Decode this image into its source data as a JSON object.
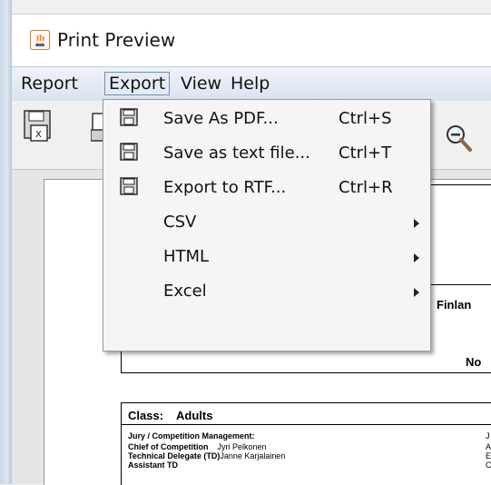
{
  "window": {
    "title": "Print Preview"
  },
  "menubar": {
    "items": [
      "Report",
      "Export",
      "View",
      "Help"
    ]
  },
  "export_menu": {
    "items": [
      {
        "label": "Save As PDF...",
        "accelerator": "Ctrl+S",
        "icon": "save-icon"
      },
      {
        "label": "Save as text file...",
        "accelerator": "Ctrl+T",
        "icon": "save-icon"
      },
      {
        "label": "Export to RTF...",
        "accelerator": "Ctrl+R",
        "icon": "save-icon"
      },
      {
        "label": "CSV",
        "submenu": true
      },
      {
        "label": "HTML",
        "submenu": true
      },
      {
        "label": "Excel",
        "submenu": true
      }
    ]
  },
  "toolbar": {
    "icons": [
      "export-excel-icon",
      "print-icon",
      "zoom-out-icon"
    ]
  },
  "report": {
    "finland_label": "Finlan",
    "no_label": "No",
    "class_label": "Class:",
    "class_value": "Adults",
    "jury_heading": "Jury / Competition Management:",
    "chief_label": "Chief of Competition",
    "chief_value": "Jyri Pelkonen",
    "td_label": "Technical Delegate (TD)",
    "td_value": "Janne Karjalainen",
    "assistant_label": "Assistant TD",
    "right_col": [
      "J",
      "A",
      "E",
      "C"
    ]
  }
}
